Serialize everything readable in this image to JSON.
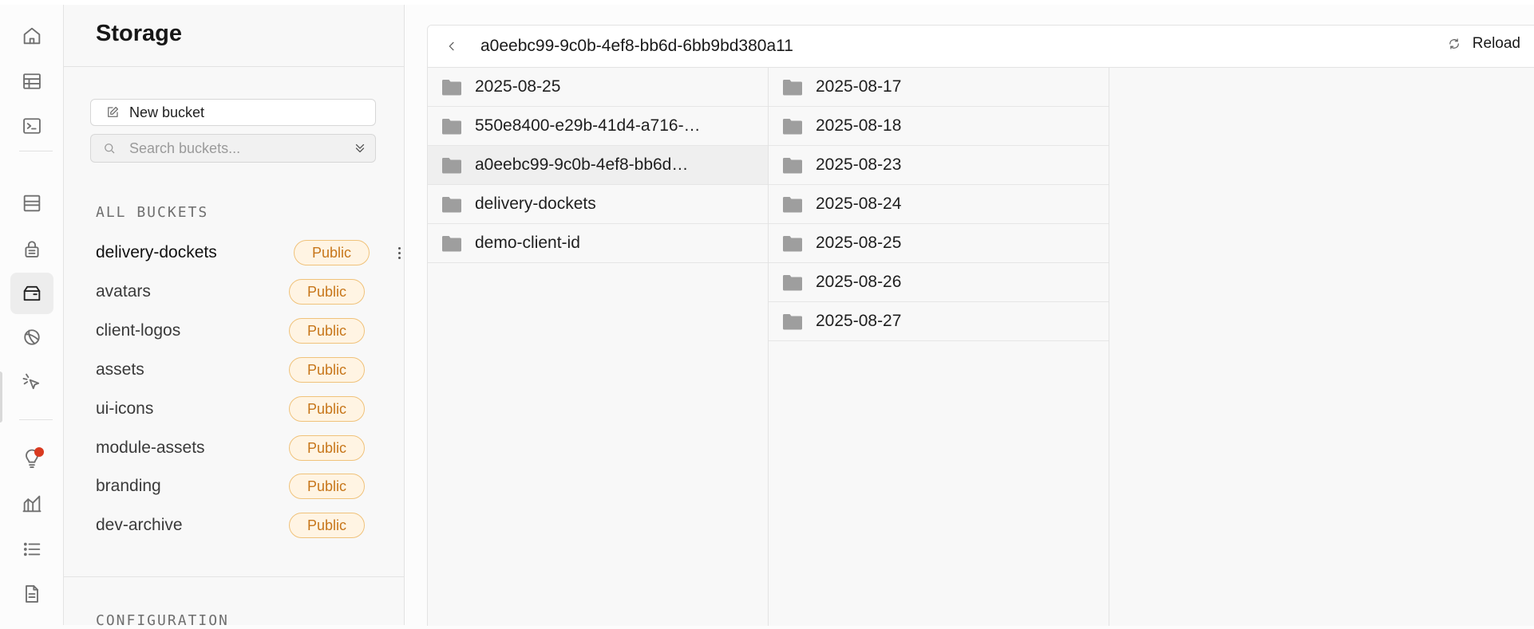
{
  "rail": {
    "items": [
      {
        "icon": "home-icon"
      },
      {
        "icon": "table-editor-icon"
      },
      {
        "icon": "sql-editor-icon"
      },
      {
        "icon": "database-icon"
      },
      {
        "icon": "auth-lock-icon"
      },
      {
        "icon": "storage-icon",
        "active": true
      },
      {
        "icon": "realtime-icon"
      },
      {
        "icon": "edge-functions-icon"
      },
      {
        "icon": "advisors-bulb-icon"
      },
      {
        "icon": "reports-icon"
      },
      {
        "icon": "logs-list-icon"
      },
      {
        "icon": "api-docs-icon"
      }
    ]
  },
  "panel": {
    "title": "Storage",
    "new_bucket_label": "New bucket",
    "search_placeholder": "Search buckets...",
    "all_buckets_label": "ALL BUCKETS",
    "buckets": [
      {
        "name": "delivery-dockets",
        "badge": "Public"
      },
      {
        "name": "avatars",
        "badge": "Public"
      },
      {
        "name": "client-logos",
        "badge": "Public"
      },
      {
        "name": "assets",
        "badge": "Public"
      },
      {
        "name": "ui-icons",
        "badge": "Public"
      },
      {
        "name": "module-assets",
        "badge": "Public"
      },
      {
        "name": "branding",
        "badge": "Public"
      },
      {
        "name": "dev-archive",
        "badge": "Public"
      }
    ],
    "configuration_label": "CONFIGURATION"
  },
  "explorer": {
    "path": "a0eebc99-9c0b-4ef8-bb6d-6bb9bd380a11",
    "reload_label": "Reload",
    "column1": [
      {
        "label": "2025-08-25"
      },
      {
        "label": "550e8400-e29b-41d4-a716-…"
      },
      {
        "label": "a0eebc99-9c0b-4ef8-bb6d…",
        "selected": true
      },
      {
        "label": "delivery-dockets"
      },
      {
        "label": "demo-client-id"
      }
    ],
    "column2": [
      {
        "label": "2025-08-17"
      },
      {
        "label": "2025-08-18"
      },
      {
        "label": "2025-08-23"
      },
      {
        "label": "2025-08-24"
      },
      {
        "label": "2025-08-25"
      },
      {
        "label": "2025-08-26"
      },
      {
        "label": "2025-08-27"
      }
    ]
  },
  "colors": {
    "badge_text": "#c7761a",
    "badge_border": "#f0c27a",
    "badge_bg": "#fff4e3",
    "folder": "#9e9e9e",
    "notification_dot": "#d93a20"
  }
}
